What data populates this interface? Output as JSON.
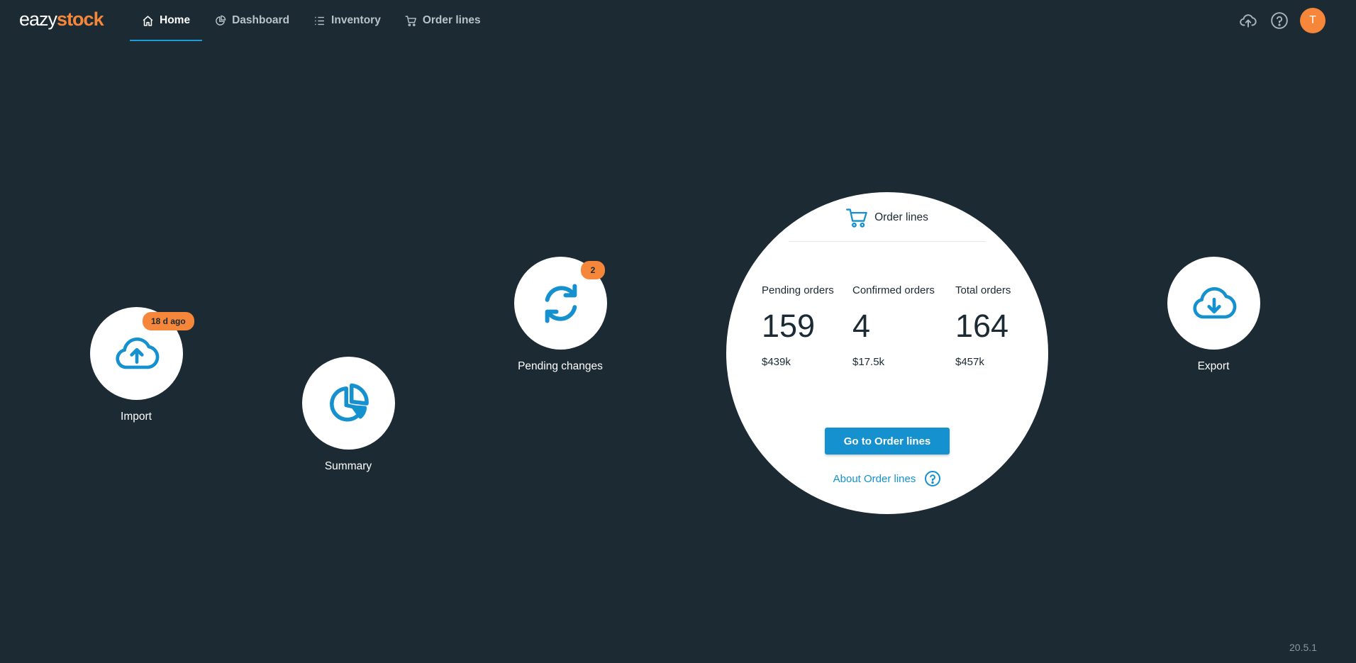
{
  "app": {
    "logo_part1": "eazy",
    "logo_part2": "stock",
    "version": "20.5.1"
  },
  "colors": {
    "background": "#1b2a33",
    "accent": "#1591cf",
    "orange": "#f5863a",
    "white": "#ffffff"
  },
  "nav": {
    "items": [
      {
        "label": "Home",
        "icon": "home-icon",
        "active": true
      },
      {
        "label": "Dashboard",
        "icon": "pie-chart-icon",
        "active": false
      },
      {
        "label": "Inventory",
        "icon": "list-icon",
        "active": false
      },
      {
        "label": "Order lines",
        "icon": "cart-icon",
        "active": false
      }
    ]
  },
  "topright": {
    "upload_icon": "cloud-upload-icon",
    "help_icon": "help-icon",
    "avatar_initial": "T"
  },
  "nodes": {
    "import": {
      "label": "Import",
      "badge": "18 d ago",
      "icon": "cloud-upload-icon"
    },
    "summary": {
      "label": "Summary",
      "icon": "pie-chart-icon"
    },
    "pending": {
      "label": "Pending changes",
      "badge": "2",
      "icon": "sync-icon"
    },
    "export": {
      "label": "Export",
      "icon": "cloud-download-icon"
    }
  },
  "order_card": {
    "title": "Order lines",
    "icon": "cart-icon",
    "stats": [
      {
        "label": "Pending orders",
        "value": "159",
        "amount": "$439k"
      },
      {
        "label": "Confirmed orders",
        "value": "4",
        "amount": "$17.5k"
      },
      {
        "label": "Total orders",
        "value": "164",
        "amount": "$457k"
      }
    ],
    "button_label": "Go to Order lines",
    "about_link": "About Order lines"
  }
}
